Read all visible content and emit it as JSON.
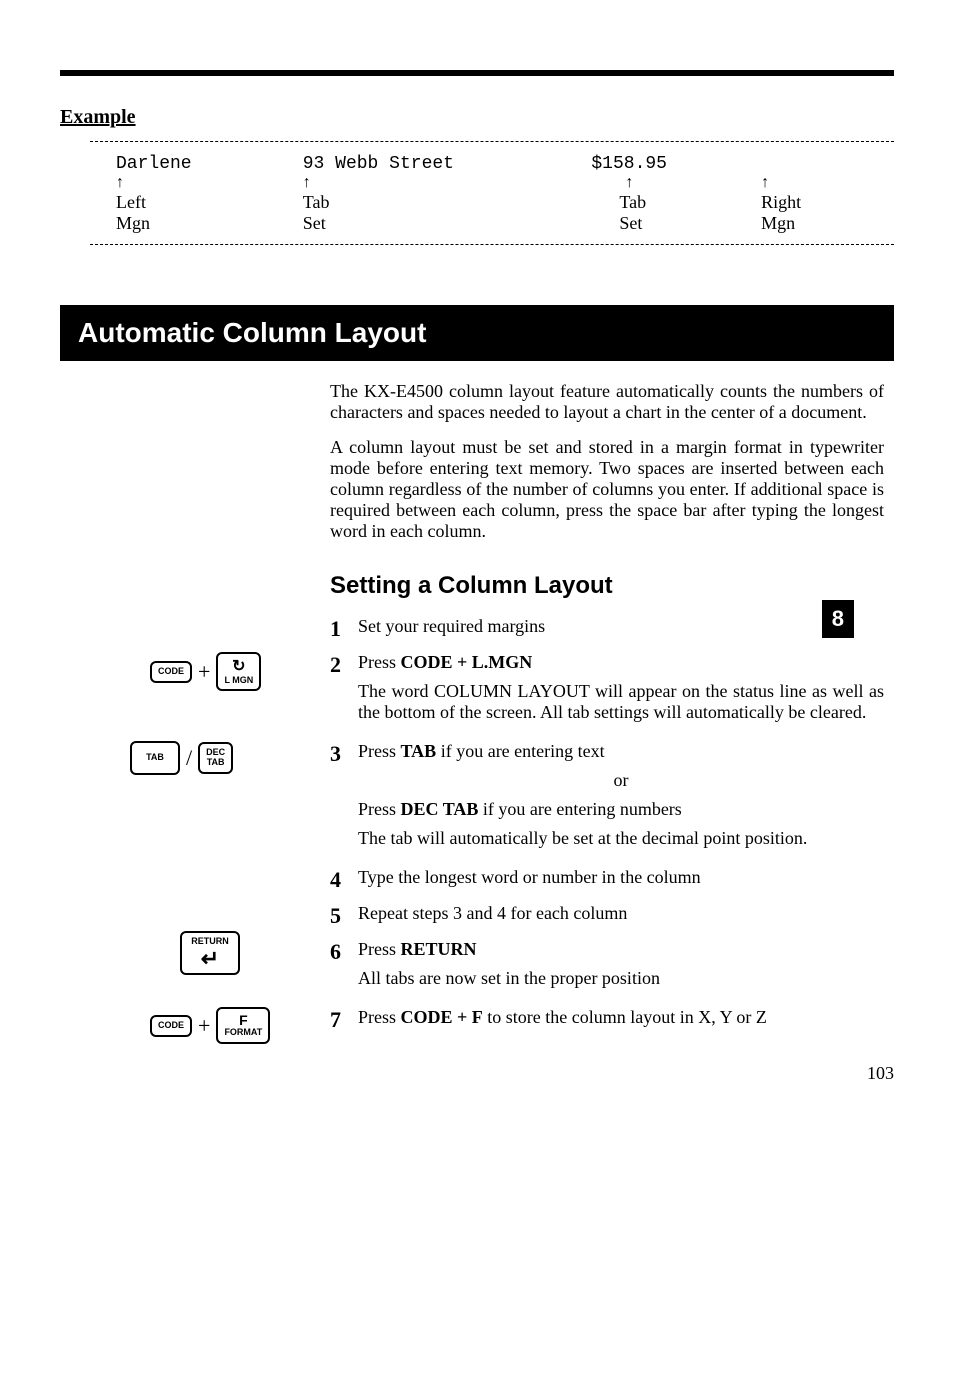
{
  "hr": "",
  "example": {
    "heading": "Example",
    "row1": {
      "c1": "Darlene",
      "c2": "93 Webb Street",
      "c3": "$158.95",
      "c4": ""
    },
    "arrows": {
      "a": "↑",
      "b": "↑",
      "c": "↑",
      "d": "↑"
    },
    "labels": {
      "c1a": "Left",
      "c1b": "Mgn",
      "c2a": "Tab",
      "c2b": "Set",
      "c3a": "Tab",
      "c3b": "Set",
      "c4a": "Right",
      "c4b": "Mgn"
    }
  },
  "section_title": "Automatic Column Layout",
  "para1": "The KX-E4500 column layout feature automatically counts the numbers of characters and spaces needed to layout a chart in the center of a document.",
  "para2": "A column layout must be set and stored in a margin format in typewriter mode before entering text memory. Two spaces are inserted between each column regardless of the number of columns you enter. If additional space is required between each column, press the space bar after typing the longest word in each column.",
  "sub_heading": "Setting a Column Layout",
  "side_tab": "8",
  "steps": {
    "s1": {
      "num": "1",
      "text": "Set your required margins"
    },
    "s2": {
      "num": "2",
      "prefix": "Press ",
      "keys": "CODE + L.MGN",
      "detail": "The word COLUMN LAYOUT will appear on the status line as well as the bottom of the screen. All tab settings will automatically be cleared."
    },
    "s3": {
      "num": "3",
      "line1_prefix": "Press ",
      "line1_key": "TAB",
      "line1_suffix": " if you are entering text",
      "or": "or",
      "line2_prefix": "Press ",
      "line2_key": "DEC TAB",
      "line2_suffix": " if you are entering numbers",
      "detail": "The tab will automatically be set at the decimal point position."
    },
    "s4": {
      "num": "4",
      "text": "Type the longest word or number in the column"
    },
    "s5": {
      "num": "5",
      "text": "Repeat steps 3 and 4 for each column"
    },
    "s6": {
      "num": "6",
      "prefix": "Press ",
      "key": "RETURN",
      "detail": "All tabs are now set in the proper position"
    },
    "s7": {
      "num": "7",
      "prefix": "Press ",
      "key": "CODE + F",
      "suffix": " to store the column layout in X, Y or Z"
    }
  },
  "keycaps": {
    "code": "CODE",
    "lmgn_top": "↻",
    "lmgn_bot": "L MGN",
    "tab": "TAB",
    "dectab_top": "DEC",
    "dectab_bot": "TAB",
    "return": "RETURN",
    "return_glyph": "↵",
    "f_top": "F",
    "f_bot": "FORMAT",
    "plus": "+",
    "slash": "/"
  },
  "page_number": "103"
}
